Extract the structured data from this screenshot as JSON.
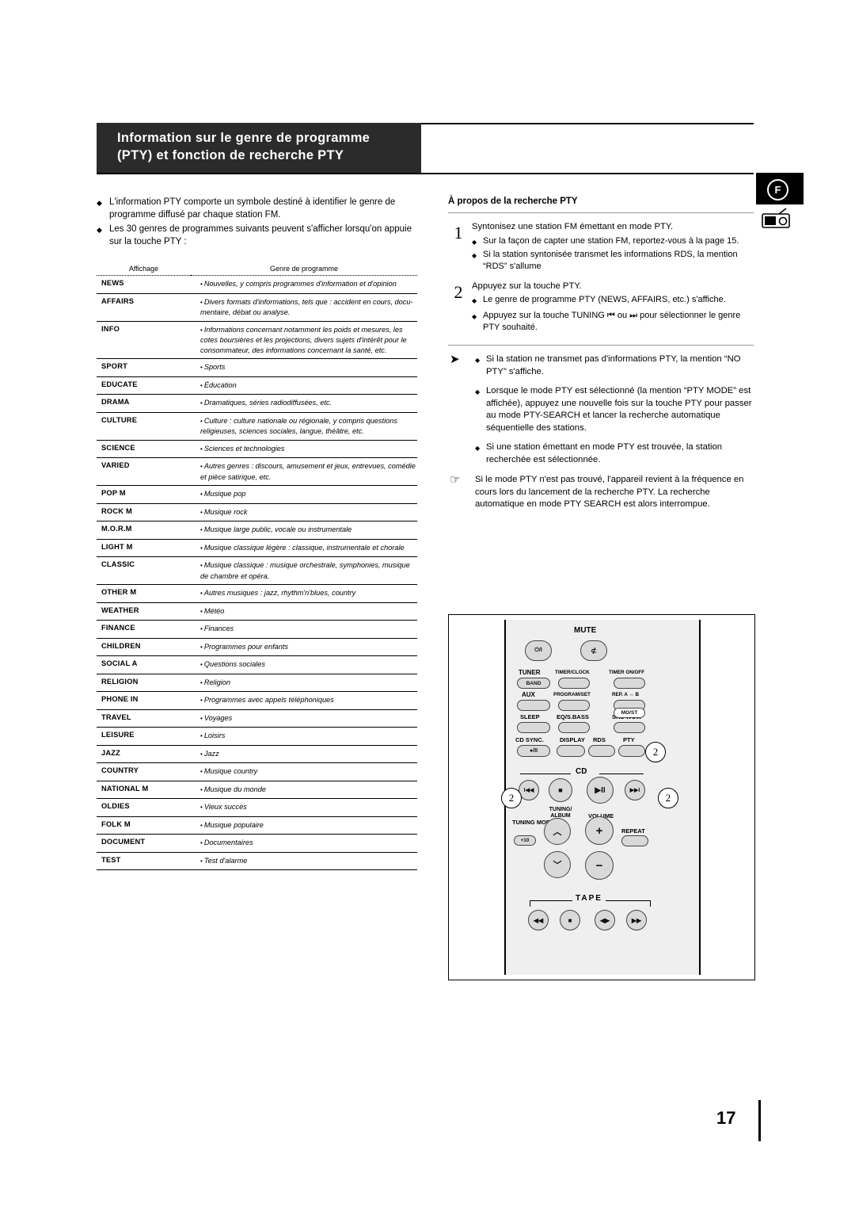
{
  "header": {
    "title_line1": "Information sur le genre de programme",
    "title_line2": "(PTY) et fonction de recherche PTY",
    "badge": "F"
  },
  "left": {
    "intro": [
      "L'information PTY comporte un symbole destiné à identifier le genre de programme diffusé par chaque station FM.",
      "Les 30 genres de programmes suivants peuvent s'afficher lorsqu'on appuie sur la touche PTY :"
    ],
    "table": {
      "head_display": "Affichage",
      "head_genre": "Genre de programme",
      "rows": [
        {
          "code": "NEWS",
          "desc": "Nouvelles, y compris programmes d'information et d'opinion"
        },
        {
          "code": "AFFAIRS",
          "desc": "Divers formats d'informations, tels que : accident en cours, docu-mentaire, débat ou analyse."
        },
        {
          "code": "INFO",
          "desc": "Informations concernant notamment les poids et mesures, les cotes boursières et les projections, divers sujets d'intérêt pour le consommateur, des informations concernant la santé, etc."
        },
        {
          "code": "SPORT",
          "desc": "Sports"
        },
        {
          "code": "EDUCATE",
          "desc": "Éducation"
        },
        {
          "code": "DRAMA",
          "desc": "Dramatiques, séries radiodiffusées, etc."
        },
        {
          "code": "CULTURE",
          "desc": "Culture : culture nationale ou régionale, y compris questions religieuses, sciences sociales, langue, théâtre, etc."
        },
        {
          "code": "SCIENCE",
          "desc": "Sciences et technologies"
        },
        {
          "code": "VARIED",
          "desc": "Autres genres : discours, amusement et jeux, entrevues, comédie et pièce satirique, etc."
        },
        {
          "code": "POP M",
          "desc": "Musique pop"
        },
        {
          "code": "ROCK M",
          "desc": "Musique rock"
        },
        {
          "code": "M.O.R.M",
          "desc": "Musique large public, vocale ou instrumentale"
        },
        {
          "code": "LIGHT M",
          "desc": "Musique classique légère : classique, instrumentale et chorale"
        },
        {
          "code": "CLASSIC",
          "desc": "Musique classique : musique orchestrale, symphonies, musique de chambre et opéra."
        },
        {
          "code": "OTHER M",
          "desc": "Autres musiques : jazz, rhythm'n'blues, country"
        },
        {
          "code": "WEATHER",
          "desc": "Météo"
        },
        {
          "code": "FINANCE",
          "desc": "Finances"
        },
        {
          "code": "CHILDREN",
          "desc": "Programmes pour enfants"
        },
        {
          "code": "SOCIAL  A",
          "desc": "Questions sociales"
        },
        {
          "code": "RELIGION",
          "desc": "Religion"
        },
        {
          "code": "PHONE IN",
          "desc": "Programmes avec appels téléphoniques"
        },
        {
          "code": "TRAVEL",
          "desc": "Voyages"
        },
        {
          "code": "LEISURE",
          "desc": "Loisirs"
        },
        {
          "code": "JAZZ",
          "desc": "Jazz"
        },
        {
          "code": "COUNTRY",
          "desc": "Musique country"
        },
        {
          "code": "NATIONAL M",
          "desc": "Musique du monde"
        },
        {
          "code": "OLDIES",
          "desc": "Vieux succès"
        },
        {
          "code": "FOLK M",
          "desc": "Musique populaire"
        },
        {
          "code": "DOCUMENT",
          "desc": "Documentaires"
        },
        {
          "code": "TEST",
          "desc": "Test d'alarme"
        }
      ]
    }
  },
  "right": {
    "title": "À propos de la recherche PTY",
    "step1": {
      "num": "1",
      "text": "Syntonisez une station FM émettant en mode PTY.",
      "subs": [
        "Sur la façon de capter une station FM, reportez-vous à la page 15.",
        "Si la station syntonisée transmet les informations RDS, la mention “RDS” s'allume"
      ]
    },
    "step2": {
      "num": "2",
      "text": "Appuyez sur la touche PTY.",
      "subs": [
        "Le genre de programme PTY (NEWS, AFFAIRS, etc.) s'affiche.",
        "Appuyez sur la touche TUNING ⏮ ou ⏭ pour sélectionner le genre PTY souhaité."
      ]
    },
    "notes1": [
      "Si la station ne transmet pas d'informations PTY, la mention “NO PTY” s'affiche.",
      "Lorsque le mode PTY est sélectionné (la mention “PTY MODE” est affichée), appuyez une nouvelle fois sur la touche PTY pour passer au mode PTY-SEARCH et lancer la recherche automatique séquentielle des stations.",
      "Si une station émettant en mode PTY est trouvée, la station recherchée est sélectionnée."
    ],
    "note2": "Si le mode PTY n'est pas trouvé, l'appareil revient à la fréquence en cours lors du lancement de la recherche PTY. La recherche automatique en mode PTY SEARCH est alors interrompue."
  },
  "remote": {
    "mute": "MUTE",
    "power": "⏻/I",
    "tuner": "TUNER",
    "timer_clock": "TIMER/CLOCK",
    "timer_onoff": "TIMER ON/OFF",
    "band": "BAND",
    "aux": "AUX",
    "program_set": "PROGRAM/SET",
    "rep_ab": "REP. A ↔ B",
    "sleep": "SLEEP",
    "eq_sbass": "EQ/S.BASS",
    "srs_wow": "SRS WOW",
    "mo_st": "MO/ST",
    "cd_sync": "CD SYNC.",
    "display": "DISPLAY",
    "rds": "RDS",
    "pty": "PTY",
    "play_pause_small": "●/II",
    "cd": "CD",
    "prev": "I◀◀",
    "stop": "■",
    "play_pause": "▶II",
    "next": "▶▶I",
    "tuning_album": "TUNING/ ALBUM",
    "volume": "VOLUME",
    "tuning_mode": "TUNING MODE",
    "plus10": "+10",
    "repeat": "REPEAT",
    "tape": "TAPE",
    "tape_rew": "◀◀",
    "tape_stop": "■",
    "tape_ffrw": "◀▶",
    "tape_ff": "▶▶",
    "callouts": [
      "2",
      "2",
      "2"
    ]
  },
  "footer": {
    "page": "17"
  }
}
